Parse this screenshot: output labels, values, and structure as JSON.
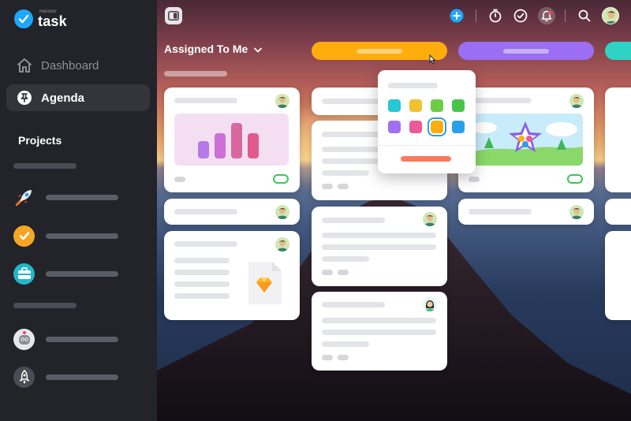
{
  "app": {
    "logo_small": "meister",
    "logo_word": "task"
  },
  "sidebar": {
    "items": [
      {
        "label": "Dashboard",
        "icon": "home-icon",
        "active": false
      },
      {
        "label": "Agenda",
        "icon": "agenda-pin-icon",
        "active": true
      }
    ],
    "projects_title": "Projects",
    "projects": [
      {
        "icon": "rocket-icon",
        "color": "#3a3c43"
      },
      {
        "icon": "check-circle-icon",
        "color": "#f5a623"
      },
      {
        "icon": "briefcase-icon",
        "color": "#23b6c8"
      },
      {
        "icon": "robot-icon",
        "color": "#ffffff"
      },
      {
        "icon": "rocket-outline-icon",
        "color": "#4a4d55"
      }
    ]
  },
  "header": {
    "view_title": "Assigned To Me",
    "icons": [
      "add-icon",
      "timer-icon",
      "checkmark-icon",
      "notification-bell-icon",
      "search-icon",
      "user-avatar"
    ]
  },
  "columns": [
    {
      "color": "#ffad0d"
    },
    {
      "color": "#9b6ef3"
    },
    {
      "color": "#2fd3c3"
    }
  ],
  "color_picker": {
    "swatches": [
      "#27c7d4",
      "#f2c12e",
      "#6ccd45",
      "#46c54a",
      "#a26ff1",
      "#ec5a98",
      "#ffad0d",
      "#2aa0e8"
    ],
    "selected_index": 6,
    "action_color": "#f97a5e"
  }
}
